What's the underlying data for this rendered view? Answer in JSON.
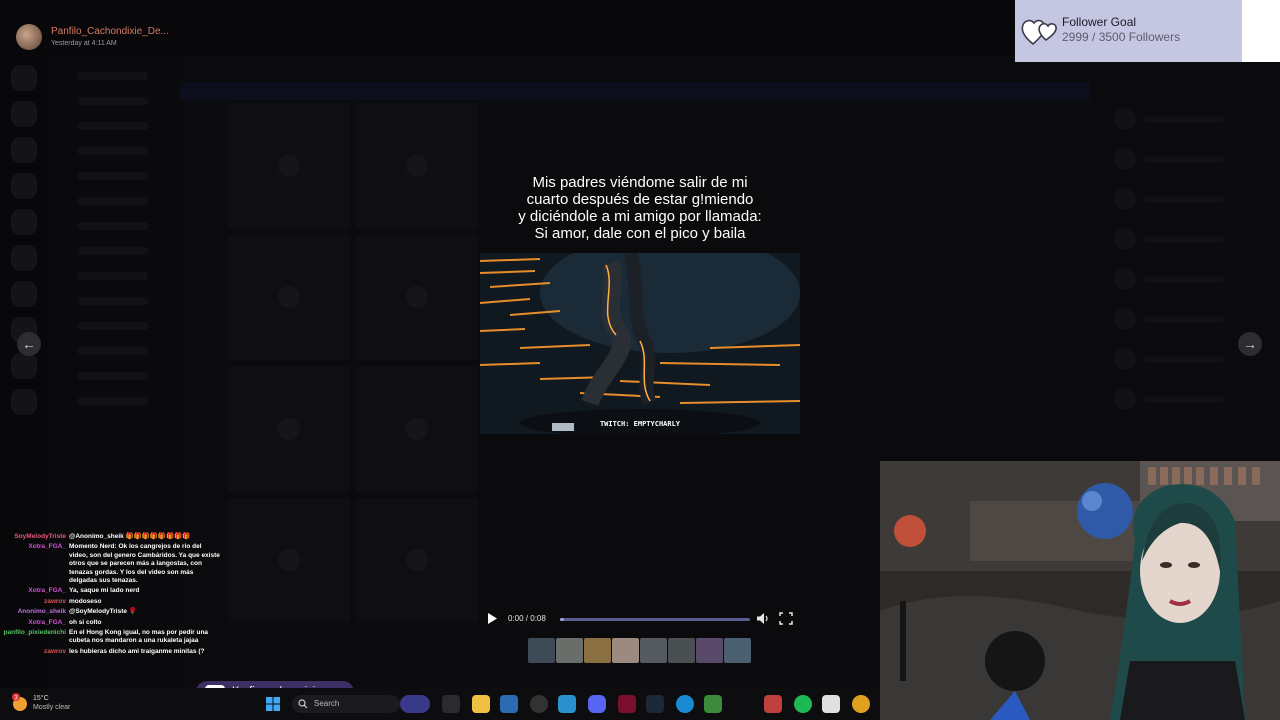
{
  "header": {
    "username": "Panfilo_Cachondixie_De...",
    "timestamp": "Yesterday at 4:11 AM"
  },
  "follower_goal": {
    "title": "Follower Goal",
    "current": 2999,
    "target": 3500,
    "count_text": "2999 / 3500 Followers"
  },
  "media": {
    "caption_lines": [
      "Mis padres viéndome salir de mi",
      "cuarto después de estar g!miendo",
      "y diciéndole a mi amigo por llamada:",
      "Si amor, dale con el pico y baila"
    ],
    "watermark": "TWITCH: EMPTYCHARLY",
    "time_text": "0:00 / 0:08",
    "progress": 0.02
  },
  "chat": {
    "messages": [
      {
        "user": "SoyMelodyTriste",
        "color": "#e8577a",
        "text": "@Anonimo_sheik 🎁🎁🎁🎁🎁🎁🎁🎁"
      },
      {
        "user": "Xotra_FGA_",
        "color": "#d94fd6",
        "text": "Momento Nerd: Ok los cangrejos de rio del video, son del genero Cambáridos. Ya que existe otros que se parecen más a langostas, con tenazas gordas. Y los del video son más delgadas sus tenazas."
      },
      {
        "user": "Xotra_FGA_",
        "color": "#d94fd6",
        "text": "Ya, saque mi lado nerd"
      },
      {
        "user": "zawrov",
        "color": "#e05050",
        "text": "modoseso"
      },
      {
        "user": "Anonimo_sheik",
        "color": "#c070e0",
        "text": "@SoyMelodyTriste 🌹"
      },
      {
        "user": "Xotra_FGA_",
        "color": "#d94fd6",
        "text": "oh si colto"
      },
      {
        "user": "panfilo_pixiedenichi",
        "color": "#58c062",
        "text": "En el Hong Kong igual, no mas por pedir una cubeta nos mandaron a una rukaleta jajaa"
      },
      {
        "user": "zawrov",
        "color": "#e05050",
        "text": "les hubieras dicho ami traiganme minitas (?"
      }
    ]
  },
  "kofi": {
    "label": "Ko-fi.com/soynixie"
  },
  "taskbar": {
    "weather_temp": "15°C",
    "weather_desc": "Mostly clear",
    "search_label": "Search",
    "notification_badge": "3"
  },
  "colors": {
    "goal_bg": "#c5c6e2",
    "progress_fill": "#9ea0d8",
    "kofi_bg": "#3d2f63",
    "username": "#d77a61"
  }
}
